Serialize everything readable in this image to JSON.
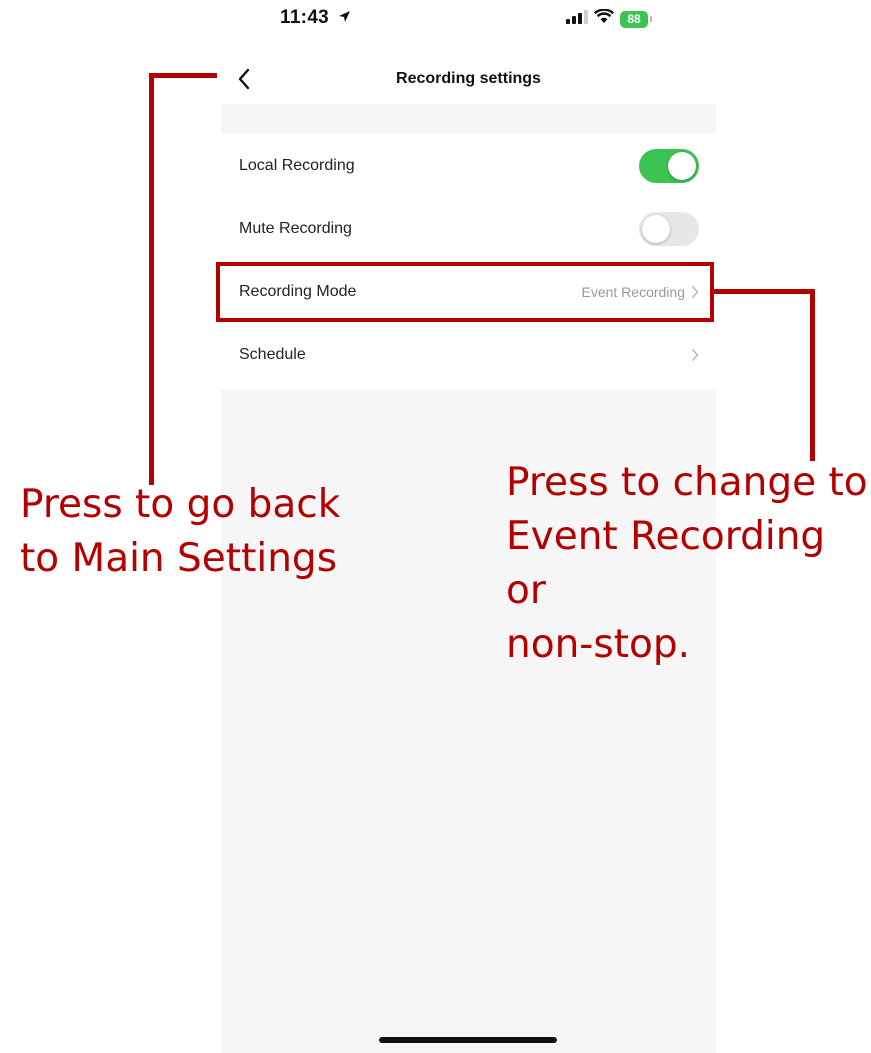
{
  "status_bar": {
    "time": "11:43",
    "battery": "88"
  },
  "nav": {
    "title": "Recording settings"
  },
  "settings": [
    {
      "label": "Local Recording",
      "toggle": "on"
    },
    {
      "label": "Mute Recording",
      "toggle": "off"
    },
    {
      "label": "Recording Mode",
      "value": "Event Recording"
    },
    {
      "label": "Schedule",
      "value": ""
    }
  ],
  "annotations": {
    "back": "Press to go back\nto Main Settings",
    "mode": "Press to change to\nEvent Recording or\nnon-stop."
  },
  "colors": {
    "toggle_on": "#3bc451",
    "toggle_off": "#e7e7e7",
    "annotation": "#b30000",
    "page_background": "#f6f6f6"
  },
  "icons": [
    "location-arrow-icon",
    "signal-icon",
    "wifi-icon",
    "battery-icon",
    "back-chevron-icon",
    "chevron-right-icon"
  ]
}
